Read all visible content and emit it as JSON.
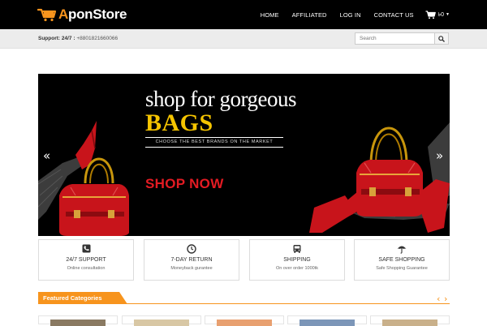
{
  "brand": {
    "prefix": "A",
    "rest": "ponStore",
    "accent": "#f7941d"
  },
  "nav": {
    "items": [
      "HOME",
      "AFFILIATED",
      "LOG IN",
      "CONTACT US"
    ],
    "cart_text": "৳0",
    "cart_icon": "shopping-cart-icon"
  },
  "support": {
    "label": "Support: 24/7 :",
    "phone": "+8801821660066"
  },
  "search": {
    "placeholder": "Search",
    "icon": "search-icon"
  },
  "hero": {
    "line1": "shop for gorgeous",
    "line2": "BAGS",
    "tagline": "CHOOSE THE BEST BRANDS ON THE MARKET",
    "cta": "SHOP NOW",
    "prev": "«",
    "next": "»",
    "highlight_color": "#f5c400",
    "cta_color": "#e41b23"
  },
  "features": [
    {
      "icon": "phone-icon",
      "title": "24/7 SUPPORT",
      "subtitle": "Online consultation"
    },
    {
      "icon": "clock-icon",
      "title": "7-DAY RETURN",
      "subtitle": "Moneyback gurantee"
    },
    {
      "icon": "bus-icon",
      "title": "SHIPPING",
      "subtitle": "On over order 1000tk"
    },
    {
      "icon": "umbrella-icon",
      "title": "SAFE SHOPPING",
      "subtitle": "Safe Shopping Guarantee"
    }
  ],
  "featured": {
    "title": "Featured Categories",
    "prev": "‹",
    "next": "›"
  }
}
